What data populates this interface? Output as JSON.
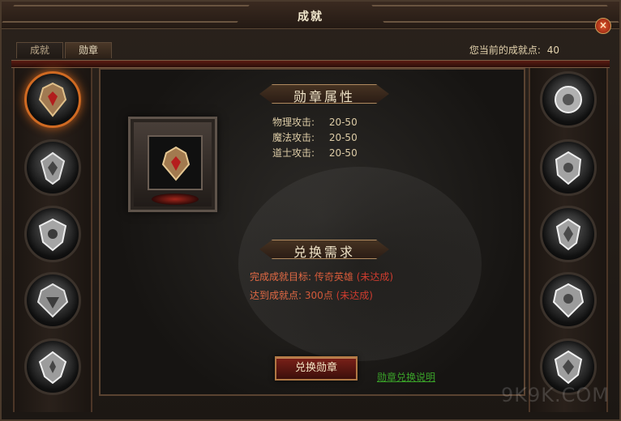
{
  "window": {
    "title": "成就",
    "close_symbol": "×",
    "tabs": [
      {
        "label": "成就"
      },
      {
        "label": "勋章"
      }
    ],
    "points_label": "您当前的成就点:",
    "points_value": "40"
  },
  "sections": {
    "attributes_title": "勋章属性",
    "requirements_title": "兑换需求"
  },
  "attributes": [
    {
      "label": "物理攻击:",
      "value": "20-50"
    },
    {
      "label": "魔法攻击:",
      "value": "20-50"
    },
    {
      "label": "道士攻击:",
      "value": "20-50"
    }
  ],
  "requirements": [
    {
      "label": "完成成就目标:",
      "target": "传奇英雄",
      "status": "(未达成)"
    },
    {
      "label": "达到成就点:",
      "target": "300点",
      "status": "(未达成)"
    }
  ],
  "actions": {
    "exchange_label": "兑换勋章",
    "explanation_link": "勋章兑换说明"
  },
  "watermark": "9K9K.COM",
  "icons": {
    "close": "close-icon",
    "medal": "medal-icon"
  },
  "colors": {
    "accent": "#c95a2a",
    "status": "#d24534",
    "link": "#3aa329"
  }
}
